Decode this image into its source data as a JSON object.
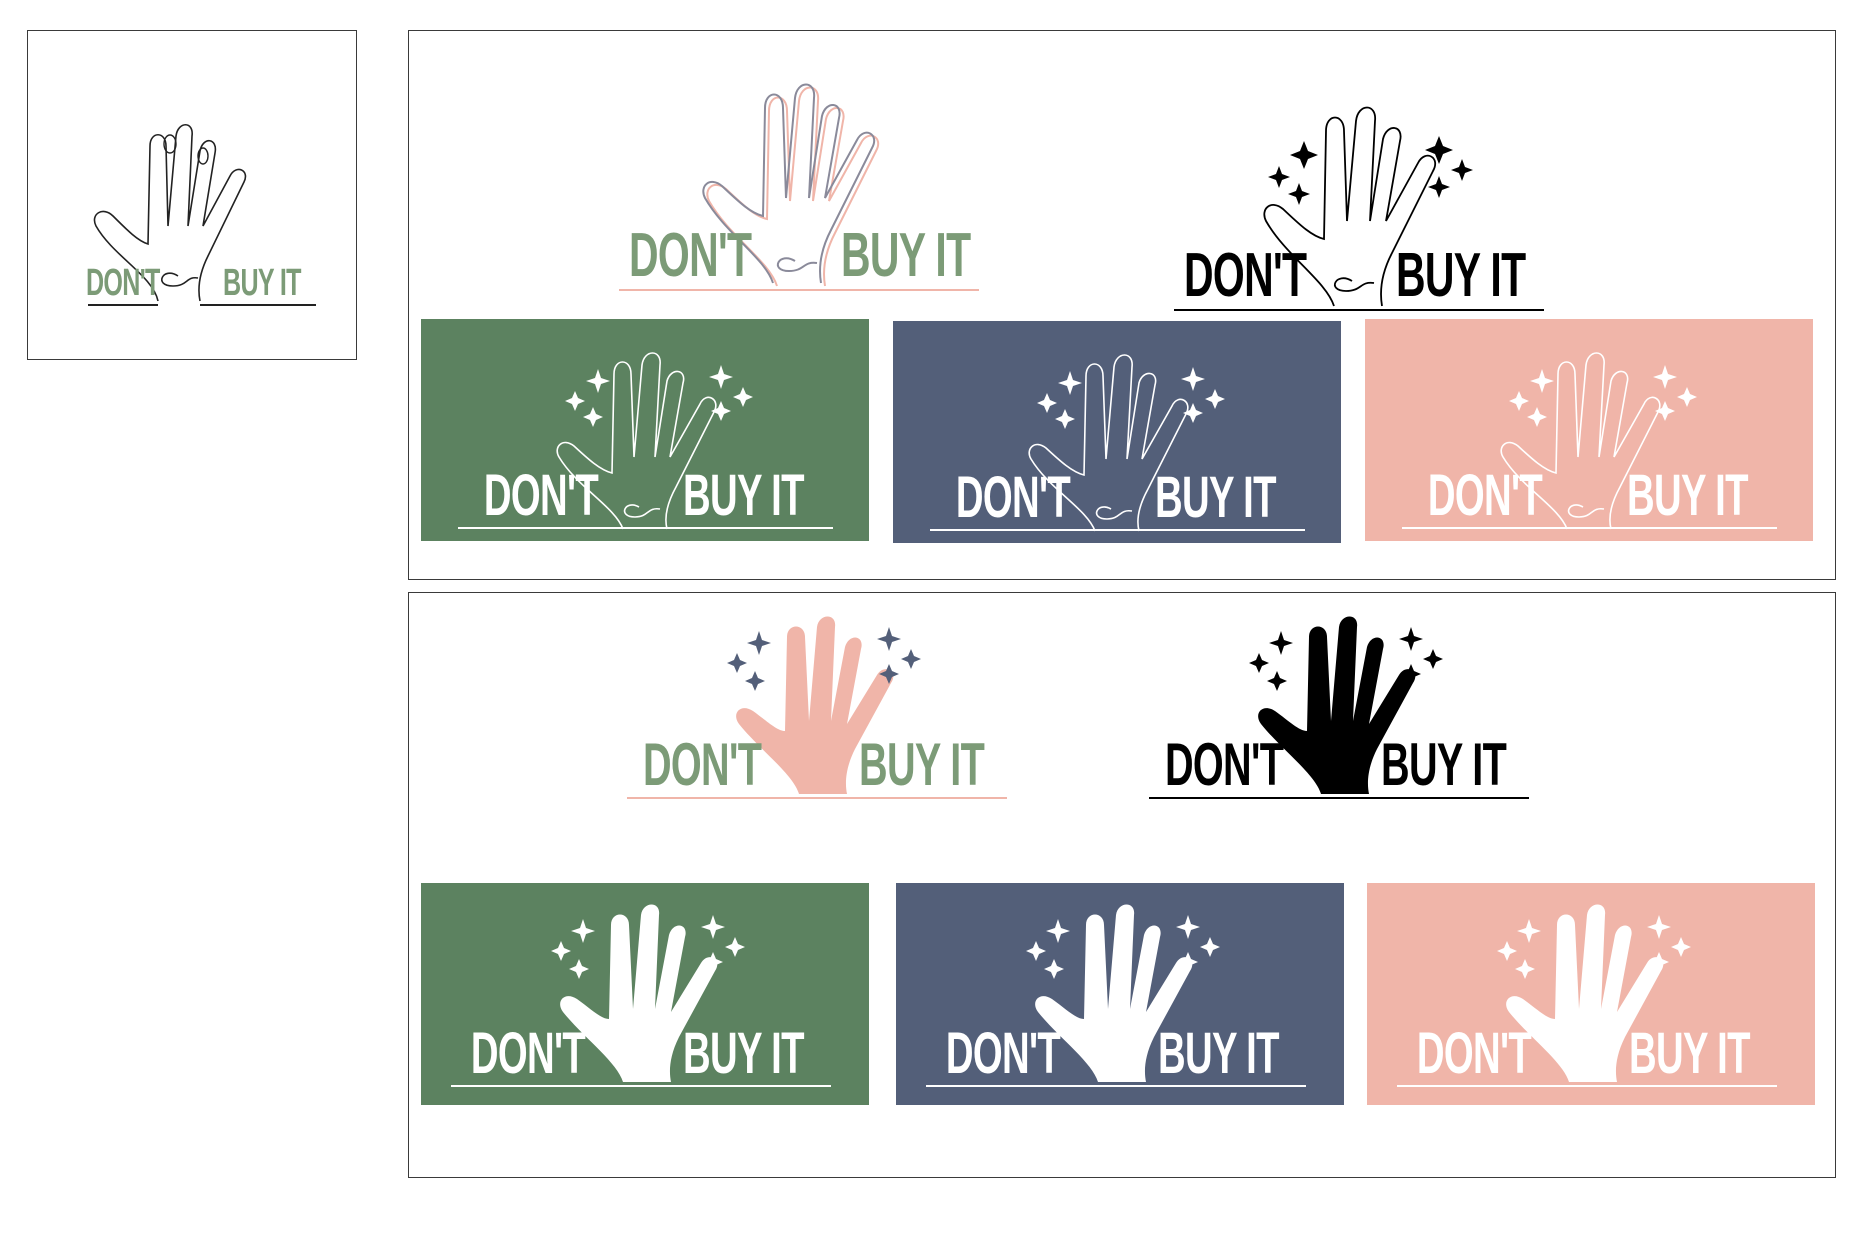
{
  "logo_text": {
    "left": "DON'T",
    "right": "BUY IT"
  },
  "palette": {
    "green": "#5c8260",
    "slate": "#535f79",
    "pink": "#f0b5a9",
    "black": "#000000",
    "white": "#ffffff",
    "sage_text": "#7c9b77"
  },
  "icons": {
    "hand": "hand-icon",
    "sparkle": "sparkle-icon"
  }
}
